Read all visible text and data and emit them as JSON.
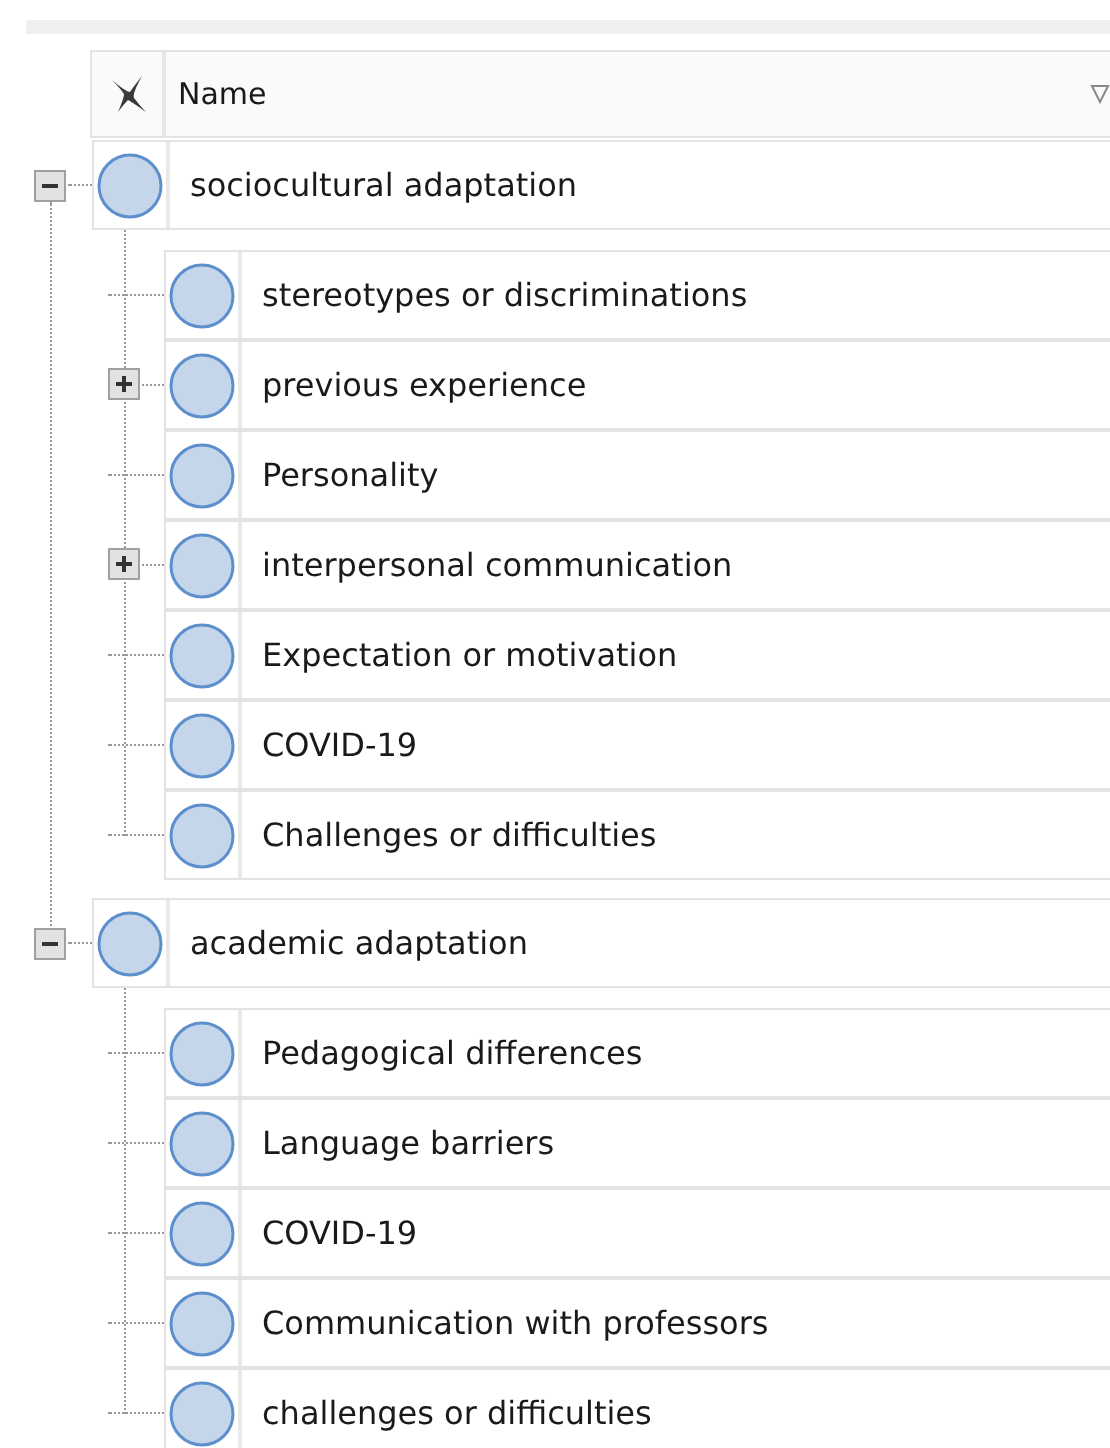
{
  "header": {
    "label": "Name"
  },
  "nodes": [
    {
      "name": "sociocultural adaptation",
      "kind": "branch",
      "expanded": true,
      "children": [
        {
          "name": "stereotypes or discriminations",
          "kind": "leaf"
        },
        {
          "name": "previous experience",
          "kind": "branch",
          "expanded": false
        },
        {
          "name": "Personality",
          "kind": "leaf"
        },
        {
          "name": "interpersonal communication",
          "kind": "branch",
          "expanded": false
        },
        {
          "name": "Expectation or motivation",
          "kind": "leaf"
        },
        {
          "name": "COVID-19",
          "kind": "leaf"
        },
        {
          "name": "Challenges or difficulties",
          "kind": "leaf"
        }
      ]
    },
    {
      "name": "academic adaptation",
      "kind": "branch",
      "expanded": true,
      "children": [
        {
          "name": "Pedagogical differences",
          "kind": "leaf"
        },
        {
          "name": "Language barriers",
          "kind": "leaf"
        },
        {
          "name": "COVID-19",
          "kind": "leaf"
        },
        {
          "name": "Communication with professors",
          "kind": "leaf"
        },
        {
          "name": "challenges or difficulties",
          "kind": "leaf"
        }
      ]
    }
  ]
}
